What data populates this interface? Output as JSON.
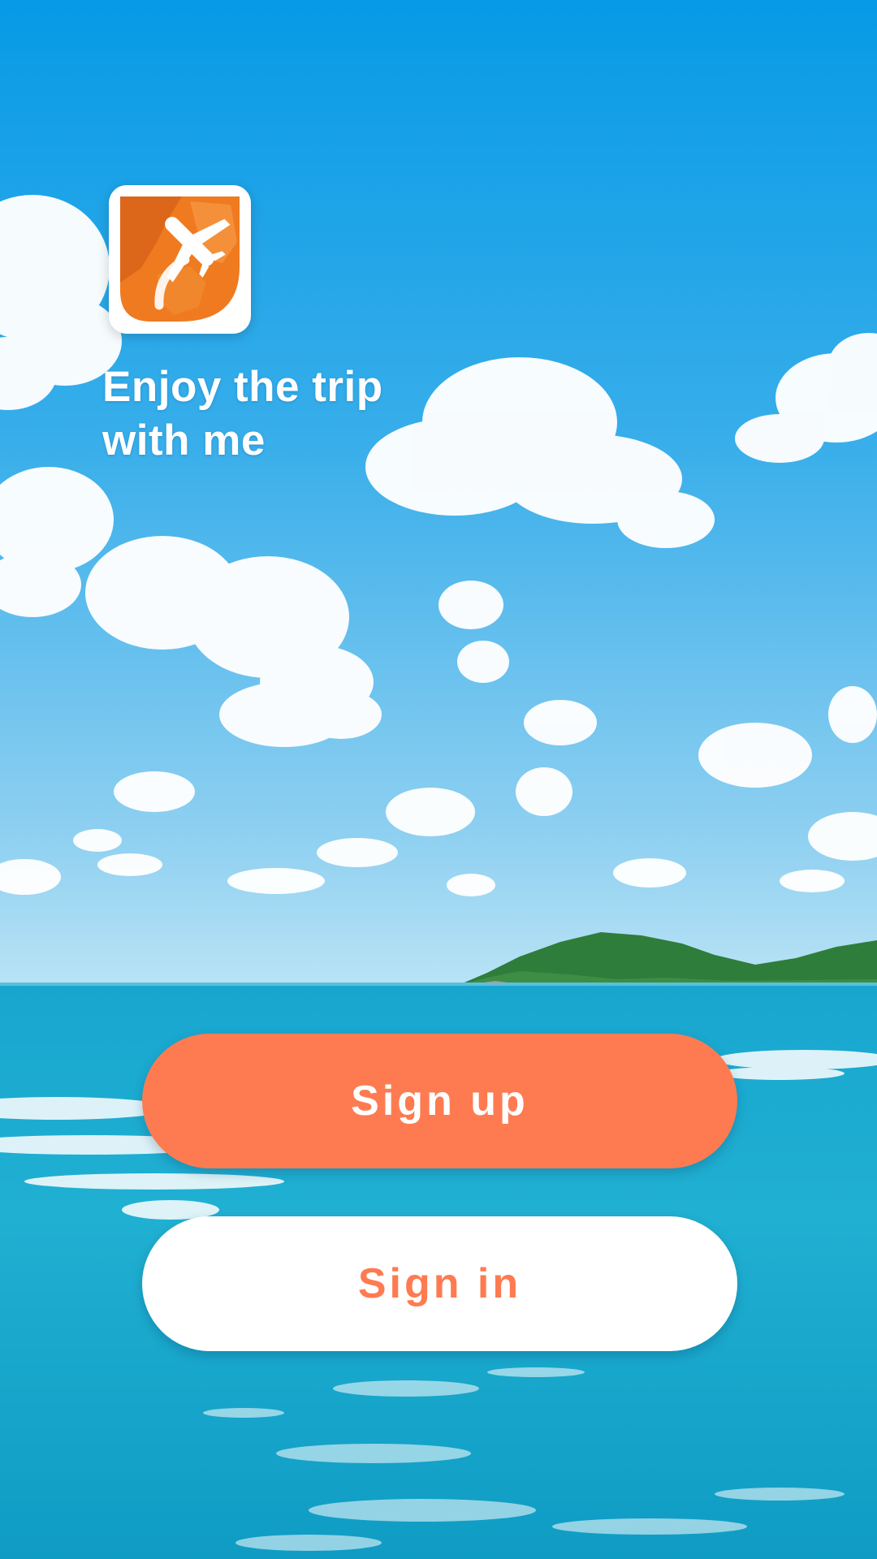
{
  "app": {
    "tagline_line1": "Enjoy the trip",
    "tagline_line2": "with me",
    "logo_icon": "airplane-globe-icon"
  },
  "buttons": {
    "signup_label": "Sign up",
    "signin_label": "Sign in"
  },
  "colors": {
    "accent": "#fe7b51",
    "sky_top": "#0a9ae6",
    "sky_horizon": "#a9dcf3",
    "sea": "#1aa9cc",
    "logo_orange": "#f07a1f"
  }
}
